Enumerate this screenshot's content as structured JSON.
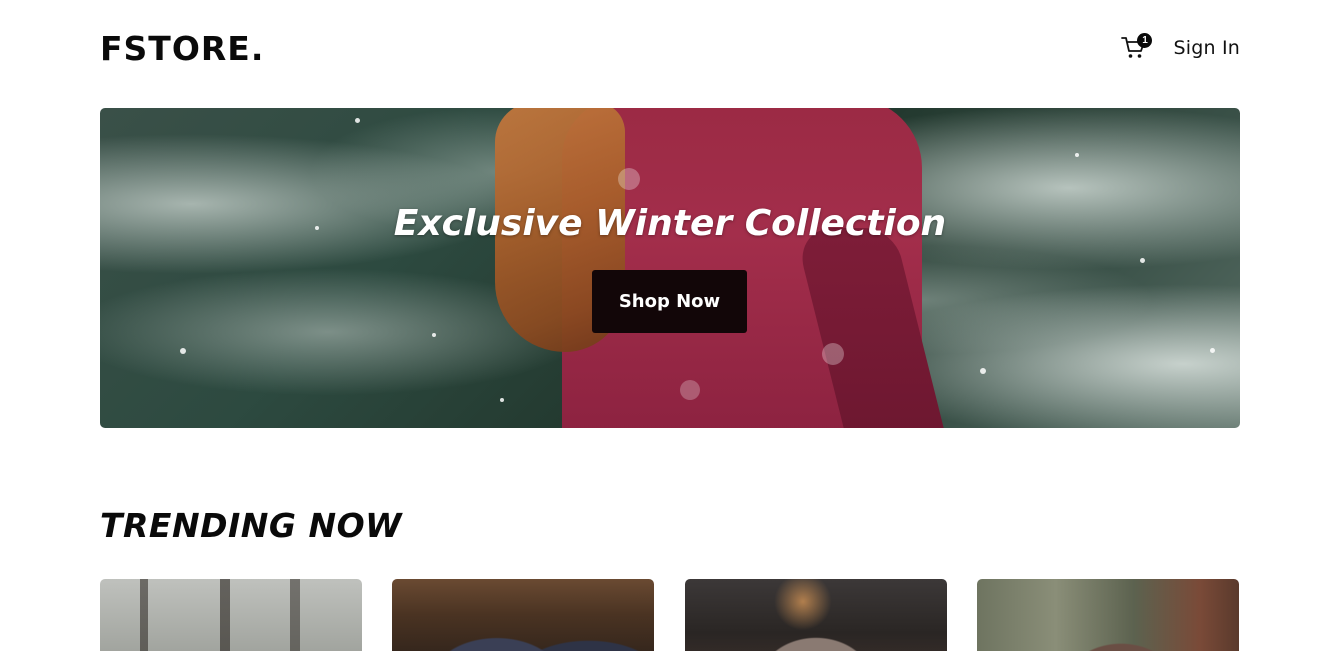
{
  "header": {
    "logo": "FSTORE.",
    "cart_count": "1",
    "signin_label": "Sign In"
  },
  "hero": {
    "title": "Exclusive Winter Collection",
    "cta_label": "Shop Now"
  },
  "trending": {
    "title": "TRENDING NOW"
  },
  "colors": {
    "text": "#0a0a0a",
    "button_bg": "#120608",
    "coat": "#a32e4b"
  }
}
